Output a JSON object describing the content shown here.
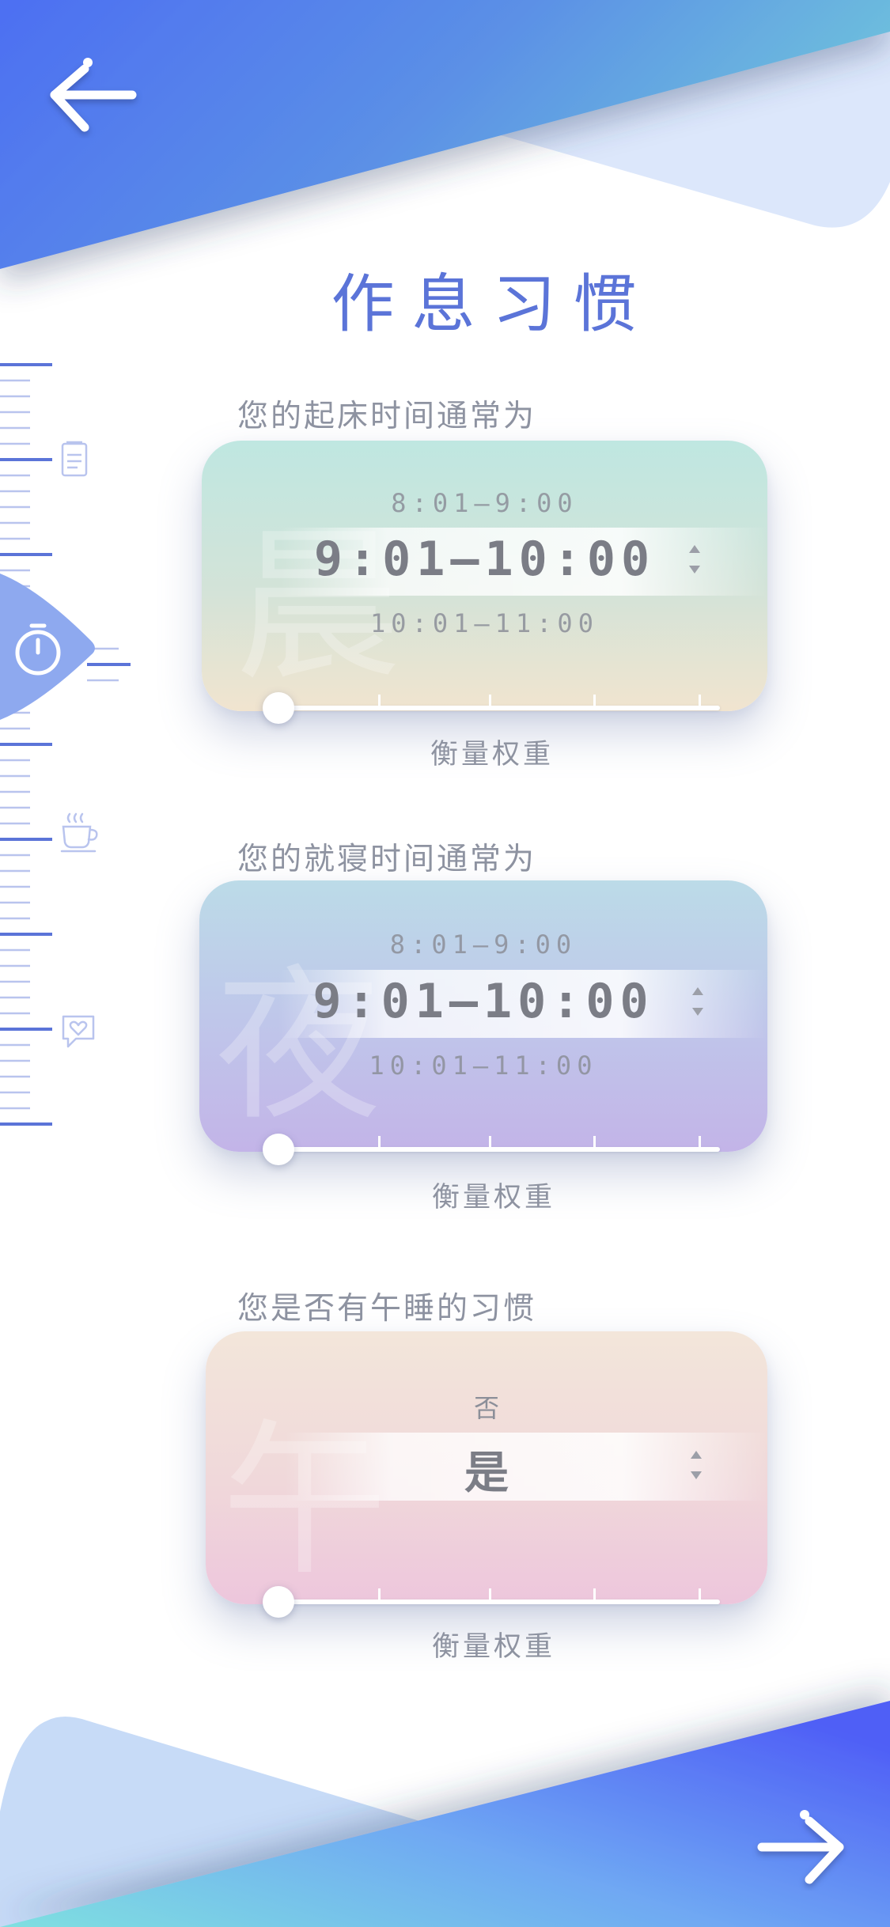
{
  "header": {
    "title": "作息习惯",
    "back_icon": "arrow-left-icon"
  },
  "side_ruler": {
    "icons": [
      "notepad-icon",
      "stopwatch-icon",
      "coffee-cup-icon",
      "heart-chat-icon"
    ],
    "active": "stopwatch-icon",
    "accent_color": "#5b74d8"
  },
  "questions": [
    {
      "label": "您的起床时间通常为",
      "watermark": "晨",
      "options": [
        "8:01—9:00",
        "9:01—10:00",
        "10:01—11:00"
      ],
      "selected": "9:01—10:00",
      "weight_label": "衡量权重",
      "weight_value": 0,
      "gradient": [
        "#bfe7e1",
        "#f1e4cf"
      ]
    },
    {
      "label": "您的就寝时间通常为",
      "watermark": "夜",
      "options": [
        "8:01—9:00",
        "9:01—10:00",
        "10:01—11:00"
      ],
      "selected": "9:01—10:00",
      "weight_label": "衡量权重",
      "weight_value": 0,
      "gradient": [
        "#bcdbe8",
        "#c3b4e8"
      ]
    },
    {
      "label": "您是否有午睡的习惯",
      "watermark": "午",
      "options": [
        "否",
        "是"
      ],
      "selected": "是",
      "weight_label": "衡量权重",
      "weight_value": 0,
      "gradient": [
        "#f3e6da",
        "#edc6dc"
      ]
    }
  ],
  "footer": {
    "next_icon": "arrow-right-icon"
  },
  "colors": {
    "primary_blue": "#4f6cf0",
    "light_blue": "#c9dcf8",
    "text_gray": "#8e93a1"
  }
}
